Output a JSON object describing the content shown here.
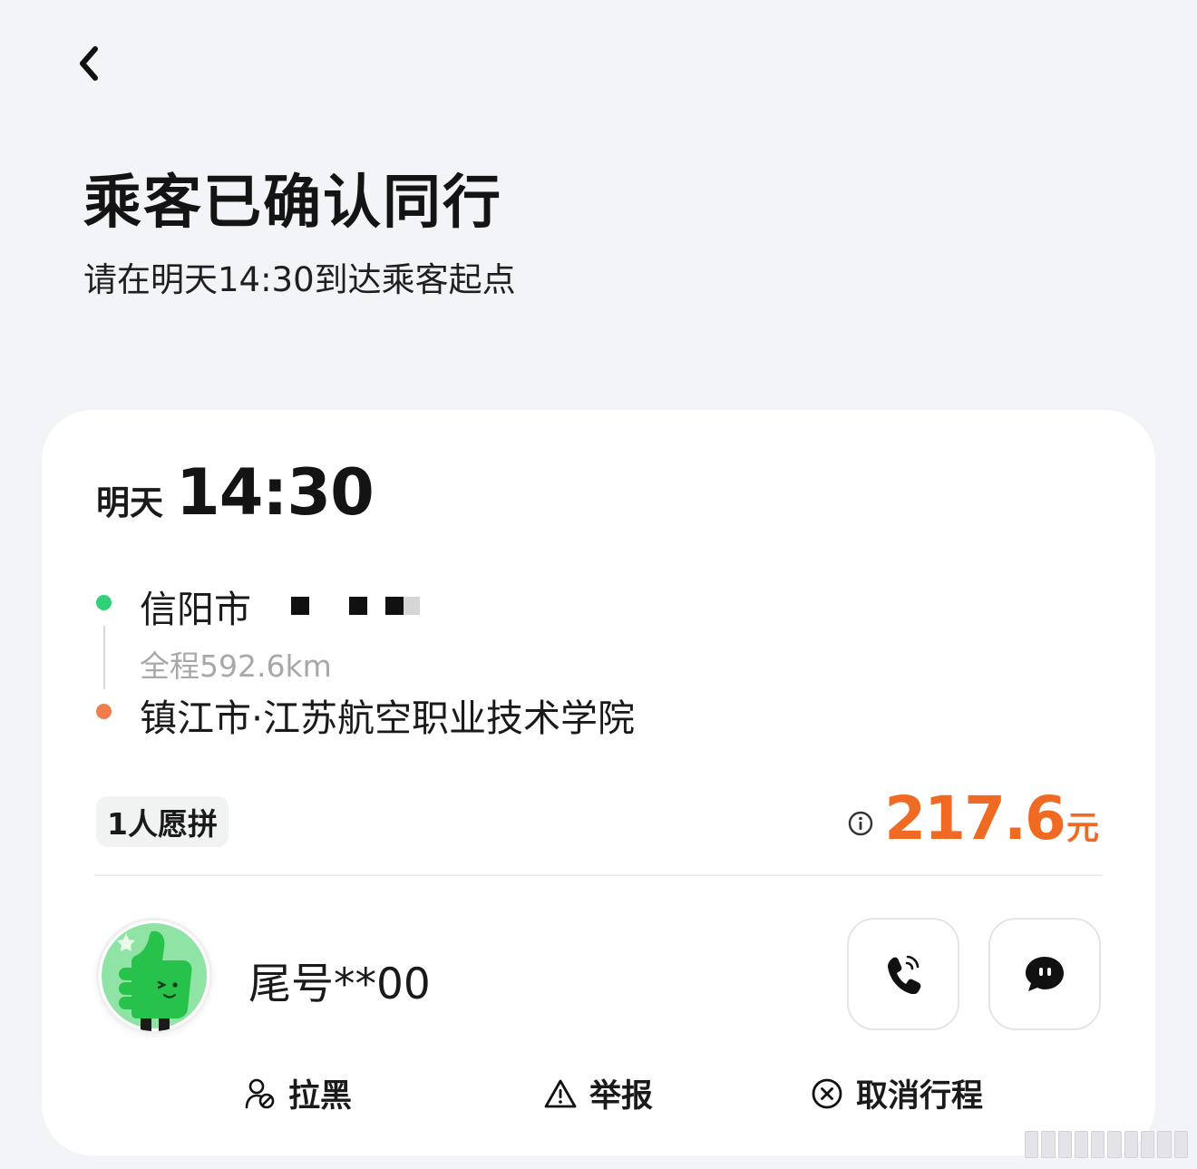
{
  "header": {
    "back_icon": "chevron-left-icon",
    "title": "乘客已确认同行",
    "subtitle": "请在明天14:30到达乘客起点"
  },
  "trip": {
    "day": "明天",
    "time": "14:30",
    "origin": "信阳市",
    "distance": "全程592.6km",
    "destination": "镇江市·江苏航空职业技术学院",
    "pool_tag": "1人愿拼",
    "price": "217.6",
    "price_unit": "元"
  },
  "passenger": {
    "name": "尾号**00",
    "avatar_icon": "thumbs-up-mascot-icon",
    "call_icon": "phone-icon",
    "chat_icon": "chat-bubble-icon"
  },
  "actions": {
    "block_label": "拉黑",
    "report_label": "举报",
    "cancel_label": "取消行程"
  },
  "colors": {
    "accent_price": "#f06a24",
    "start_dot": "#2fd17a",
    "end_dot": "#ef7d4e",
    "background": "#f3f4f8"
  }
}
